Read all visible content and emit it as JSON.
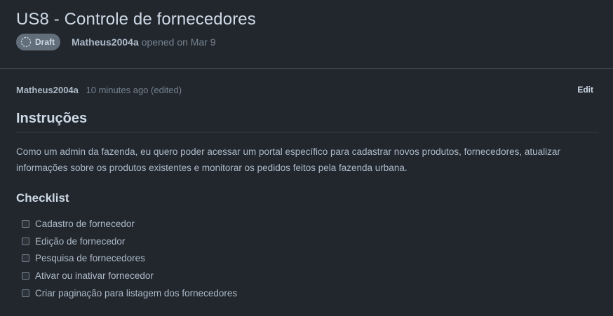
{
  "issue": {
    "title": "US8 - Controle de fornecedores",
    "status_badge": "Draft",
    "author": "Matheus2004a",
    "opened_text": "opened on Mar 9"
  },
  "comment": {
    "author": "Matheus2004a",
    "time": "10 minutes ago (edited)",
    "edit_label": "Edit",
    "heading": "Instruções",
    "body": "Como um admin da fazenda, eu quero poder acessar um portal específico para cadastrar novos produtos, fornecedores, atualizar informações sobre os produtos existentes e monitorar os pedidos feitos pela fazenda urbana.",
    "checklist_heading": "Checklist",
    "checklist": [
      {
        "label": "Cadastro de fornecedor",
        "checked": false
      },
      {
        "label": "Edição de fornecedor",
        "checked": false
      },
      {
        "label": "Pesquisa de fornecedores",
        "checked": false
      },
      {
        "label": "Ativar ou inativar fornecedor",
        "checked": false
      },
      {
        "label": "Criar paginação para listagem dos fornecedores",
        "checked": false
      }
    ]
  },
  "icons": {
    "draft": "draft-circle-icon"
  },
  "colors": {
    "background": "#22272e",
    "badge": "#636e7b",
    "heading_text": "#cdd9e5",
    "muted_text": "#768390"
  }
}
